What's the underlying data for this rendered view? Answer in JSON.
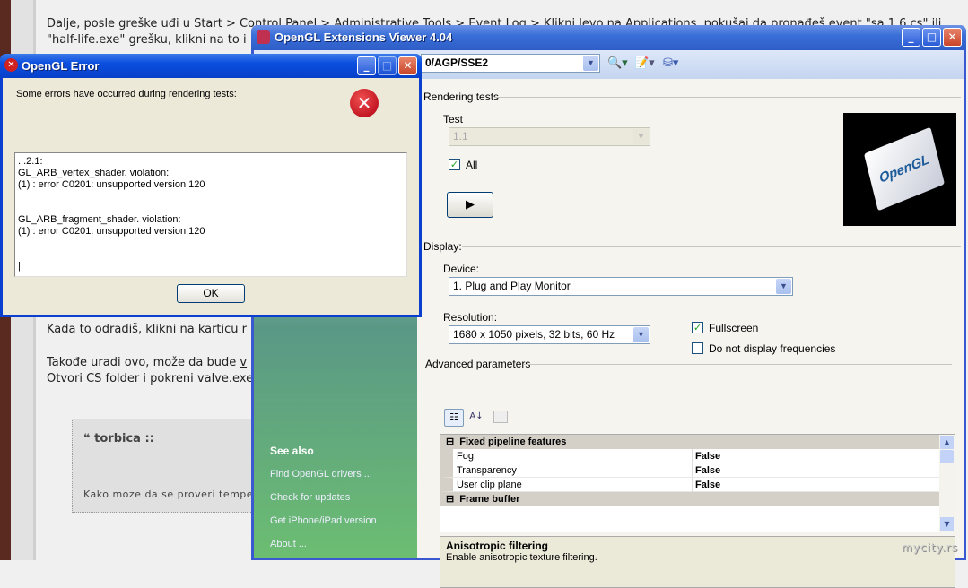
{
  "background_page": {
    "line1": "Dalje, posle greške uđi u Start > Control Panel > Administrative Tools > Event Log > Klikni levo na Applications, pokušaj da pronađeš event \"sa 1.6 cs\" ili",
    "line2": "\"half-life.exe\" grešku, klikni na to i",
    "line3": "Kada to odradiš, klikni na karticu r",
    "line4": "Takođe uradi ovo, može da bude ",
    "line4_link": "v",
    "line5": "Otvori CS folder i pokreni valve.exe",
    "quote_author": "torbica ::",
    "quote_text": "Kako moze da se proveri temper"
  },
  "viewer": {
    "title": "OpenGL Extensions Viewer 4.04",
    "renderer_combo": "0/AGP/SSE2",
    "see_also": {
      "title": "See also",
      "links": [
        "Find OpenGL drivers ...",
        "Check for updates",
        "Get iPhone/iPad version",
        "About ..."
      ]
    },
    "rendering_tests": {
      "section": "Rendering tests",
      "test_label": "Test",
      "test_value": "1.1",
      "all_label": "All",
      "all_checked": true
    },
    "display": {
      "section": "Display:",
      "device_label": "Device:",
      "device_value": "1. Plug and Play Monitor",
      "resolution_label": "Resolution:",
      "resolution_value": "1680 x 1050 pixels, 32 bits, 60 Hz",
      "fullscreen_label": "Fullscreen",
      "fullscreen_checked": true,
      "nofreq_label": "Do not display frequencies",
      "nofreq_checked": false
    },
    "advanced": {
      "section": "Advanced parameters",
      "rows": [
        {
          "type": "category",
          "name": "Fixed pipeline features"
        },
        {
          "type": "prop",
          "name": "Fog",
          "value": "False"
        },
        {
          "type": "prop",
          "name": "Transparency",
          "value": "False"
        },
        {
          "type": "prop",
          "name": "User clip plane",
          "value": "False"
        },
        {
          "type": "category",
          "name": "Frame buffer"
        }
      ],
      "desc_title": "Anisotropic filtering",
      "desc_text": "Enable anisotropic texture filtering."
    },
    "logo_text": "OpenGL"
  },
  "error_dialog": {
    "title": "OpenGL Error",
    "message": "Some errors have occurred during rendering tests:",
    "details": "...2.1:\nGL_ARB_vertex_shader. violation:\n(1) : error C0201: unsupported version 120\n\n\nGL_ARB_fragment_shader. violation:\n(1) : error C0201: unsupported version 120\n\n\n|",
    "ok_label": "OK"
  },
  "watermark": "mycity.rs"
}
